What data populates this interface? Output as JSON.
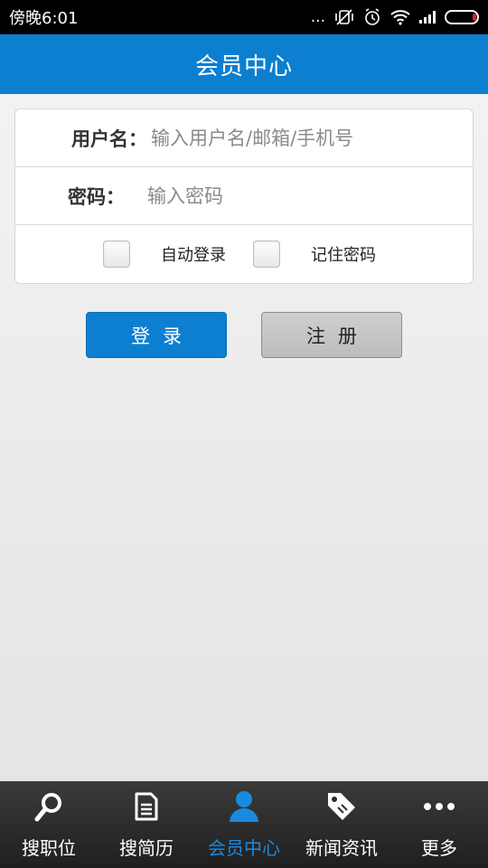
{
  "status_bar": {
    "time": "傍晚6:01",
    "dots": "...",
    "colors": {
      "background": "#000000",
      "battery_low": "#e02020"
    }
  },
  "header": {
    "title": "会员中心",
    "color": "#0c7fd1"
  },
  "login_form": {
    "username_label": "用户名：",
    "username_placeholder": "输入用户名/邮箱/手机号",
    "password_label": "密码：",
    "password_placeholder": "输入密码",
    "auto_login_label": "自动登录",
    "remember_password_label": "记住密码"
  },
  "buttons": {
    "login_label": "登录",
    "register_label": "注册"
  },
  "bottom_nav": {
    "items": [
      {
        "label": "搜职位",
        "icon": "search-icon",
        "active": false
      },
      {
        "label": "搜简历",
        "icon": "document-icon",
        "active": false
      },
      {
        "label": "会员中心",
        "icon": "user-icon",
        "active": true
      },
      {
        "label": "新闻资讯",
        "icon": "tag-icon",
        "active": false
      },
      {
        "label": "更多",
        "icon": "more-icon",
        "active": false
      }
    ],
    "active_color": "#1a8ae0"
  }
}
